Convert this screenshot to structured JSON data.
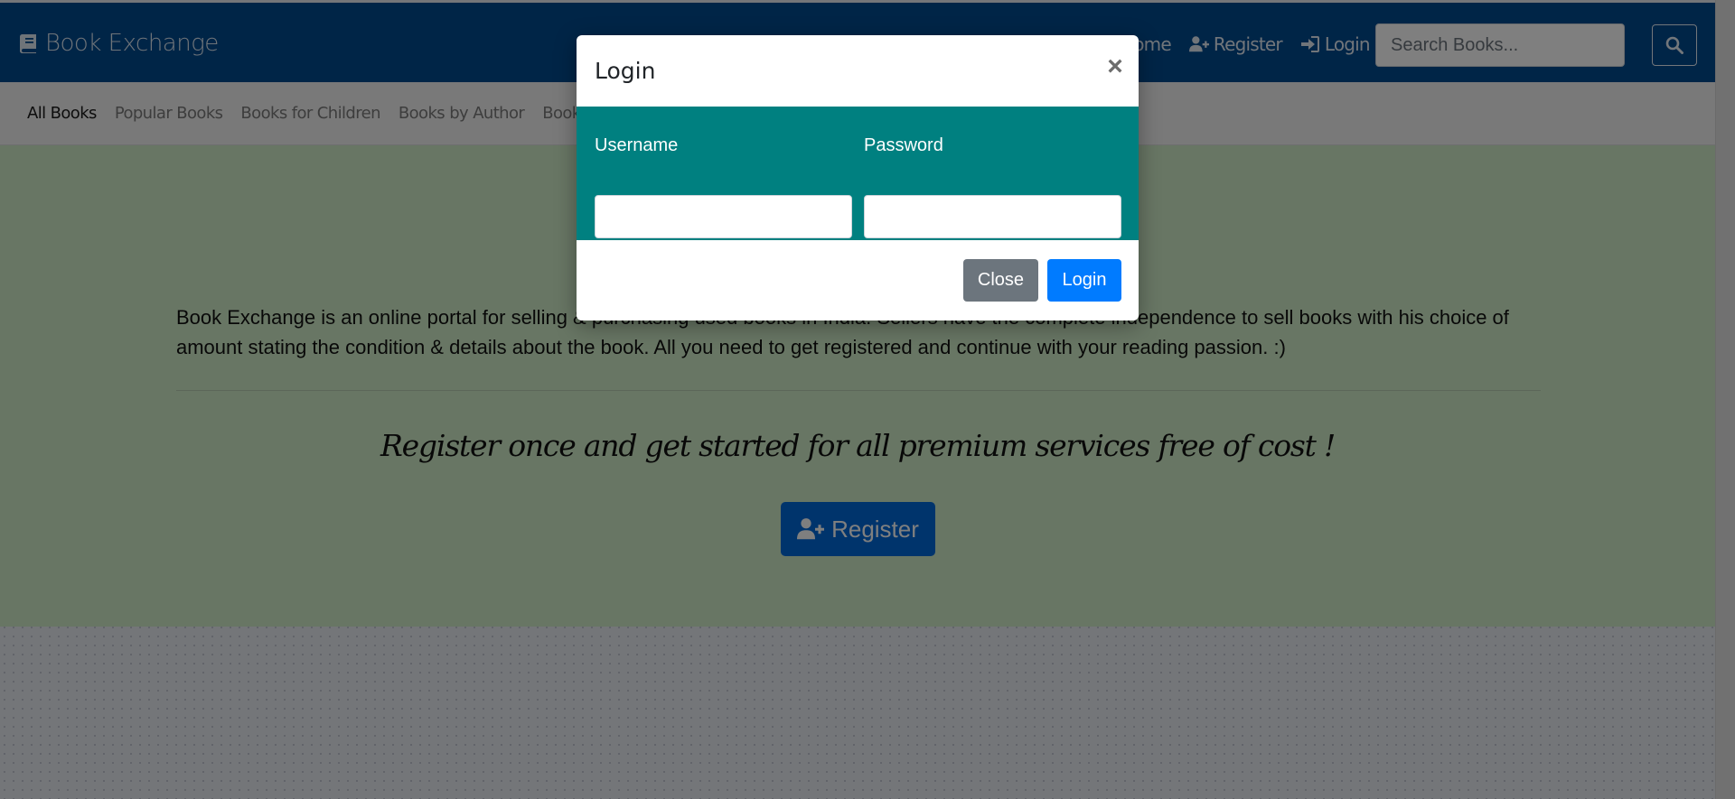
{
  "navbar": {
    "brand": "Book Exchange",
    "links": [
      {
        "label": "Home",
        "icon": "home-icon"
      },
      {
        "label": "Register",
        "icon": "user-plus-icon"
      },
      {
        "label": "Login",
        "icon": "sign-in-icon"
      }
    ],
    "search": {
      "placeholder": "Search Books...",
      "value": ""
    }
  },
  "subnav": {
    "items": [
      "All Books",
      "Popular Books",
      "Books for Children",
      "Books by Author",
      "Books"
    ]
  },
  "hero": {
    "about": "Book Exchange is an online portal for selling & purchasing used books in India. Sellers have the complete independence to sell books with his choice of amount stating the condition & details about the book. All you need to get registered and continue with your reading passion. :)",
    "tagline": "Register once and get started for all premium services free of cost !",
    "register_label": "Register"
  },
  "modal": {
    "title": "Login",
    "close_symbol": "×",
    "username_label": "Username",
    "password_label": "Password",
    "username_value": "",
    "password_value": "",
    "close_label": "Close",
    "login_label": "Login"
  },
  "colors": {
    "navbar": "#004a8f",
    "modal_body": "#008080",
    "primary": "#007bff",
    "secondary": "#6c757d",
    "hero": "#d1ecc8"
  }
}
